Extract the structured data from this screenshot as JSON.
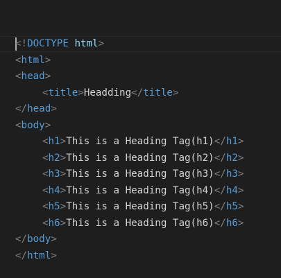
{
  "editor": {
    "doctype": {
      "open": "<!",
      "keyword": "DOCTYPE",
      "value": "html",
      "close": ">"
    },
    "tags": {
      "html": "html",
      "head": "head",
      "title": "title",
      "body": "body",
      "h1": "h1",
      "h2": "h2",
      "h3": "h3",
      "h4": "h4",
      "h5": "h5",
      "h6": "h6"
    },
    "content": {
      "title_text": "Headding",
      "h1_text": "This is a Heading Tag(h1)",
      "h2_text": "This is a Heading Tag(h2)",
      "h3_text": "This is a Heading Tag(h3)",
      "h4_text": "This is a Heading Tag(h4)",
      "h5_text": "This is a Heading Tag(h5)",
      "h6_text": "This is a Heading Tag(h6)"
    },
    "punct": {
      "lt": "<",
      "gt": ">",
      "lt_slash": "</"
    }
  }
}
